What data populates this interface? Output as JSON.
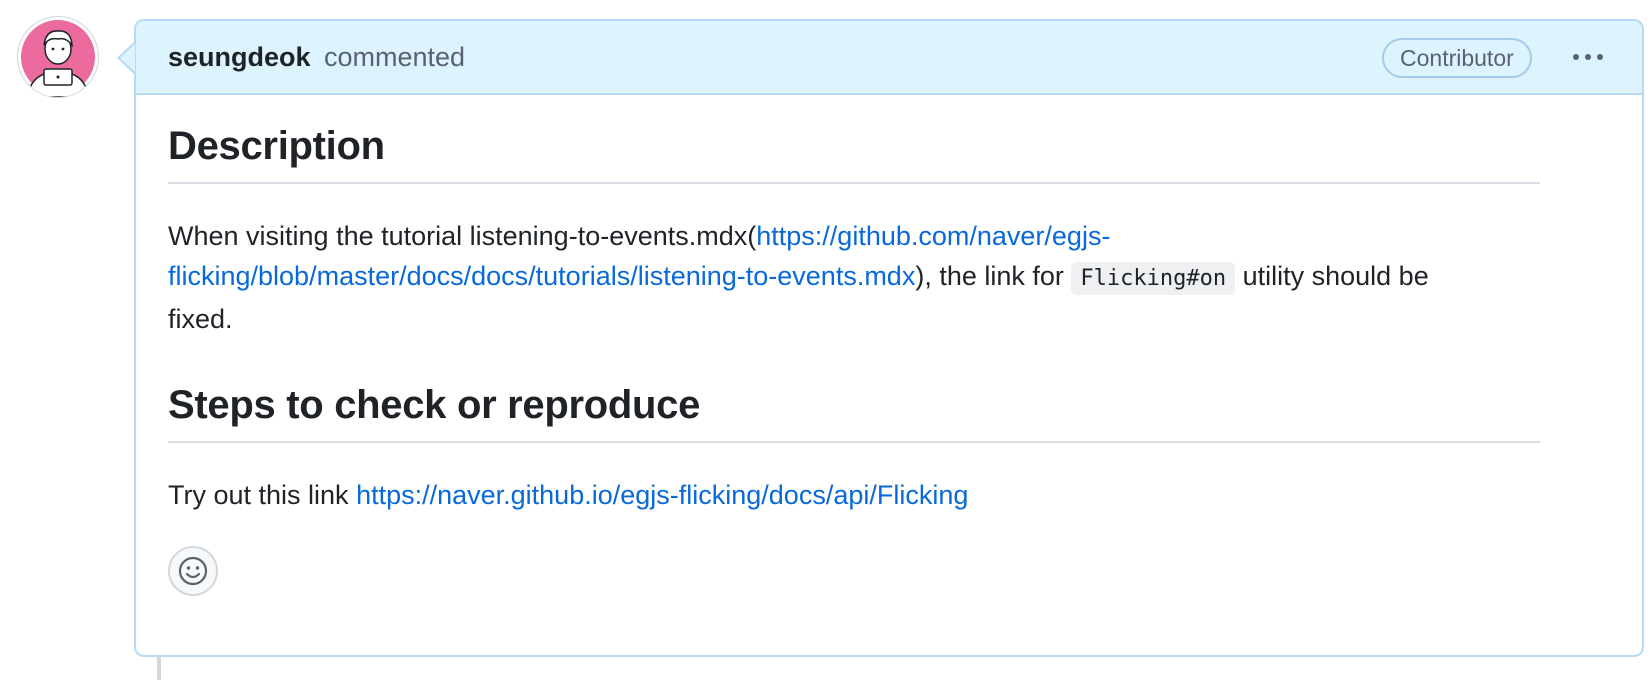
{
  "comment": {
    "author": "seungdeok",
    "action": "commented",
    "badge": "Contributor",
    "menu_icon": "kebab-horizontal-icon",
    "avatar_icon": "avatar-illustration",
    "reaction_icon": "smiley-icon"
  },
  "body": {
    "heading1": "Description",
    "p1_before": "When visiting the tutorial listening-to-events.mdx(",
    "p1_link_a": "https://github.com/naver/egjs-",
    "p1_link_b": "flicking/blob/master/docs/docs/tutorials/listening-to-events.mdx",
    "p1_mid": "), the link for ",
    "p1_code": "Flicking#on",
    "p1_after": " utility should be",
    "p1_end": "fixed.",
    "heading2": "Steps to check or reproduce",
    "p2_before": "Try out this link ",
    "p2_link": "https://naver.github.io/egjs-flicking/docs/api/Flicking"
  },
  "colors": {
    "header_bg": "#ddf4ff",
    "border": "#b6daf5",
    "link": "#0969da",
    "avatar_bg": "#eb6b9e"
  }
}
